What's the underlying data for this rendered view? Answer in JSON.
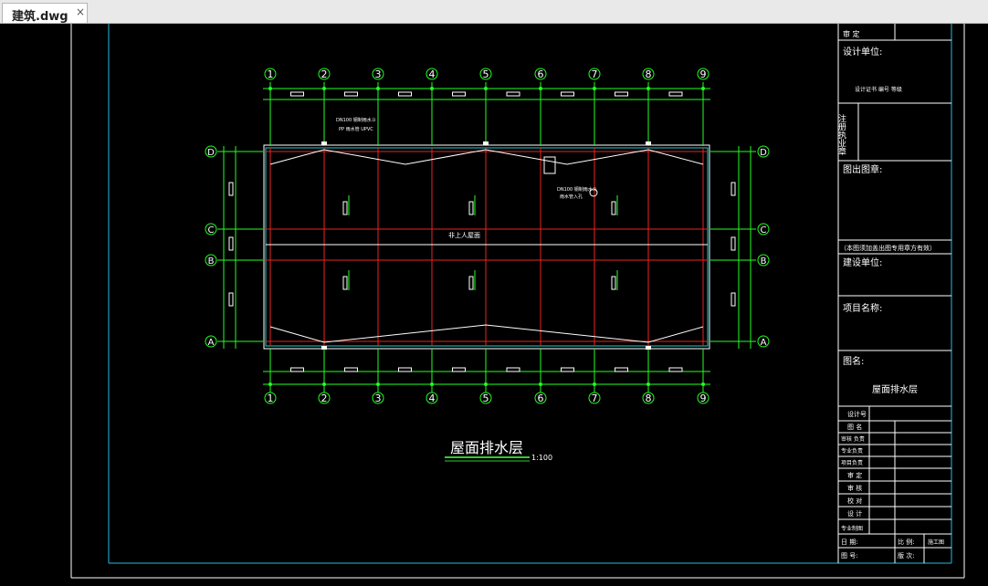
{
  "tab": {
    "filename": "建筑.dwg",
    "close_glyph": "×"
  },
  "drawing": {
    "roof_label": "非上人屋面",
    "note_left": "DN100 钢制雨水斗",
    "note_left_2": "PP 雨水管 UPVC",
    "note_right": "DN100 钢制雨水斗",
    "note_right_2": "雨水管入孔",
    "title": "屋面排水层",
    "scale": "1:100",
    "axis_numbers": [
      "1",
      "2",
      "3",
      "4",
      "5",
      "6",
      "7",
      "8",
      "9"
    ],
    "axis_letters": [
      "D",
      "C",
      "B",
      "A"
    ]
  },
  "title_block": {
    "row_top": "审 定",
    "design_unit": "设计单位:",
    "stamp_small": "设计证书 编号 等级",
    "reg_stamp": "注册执业章",
    "issue_stamp": "图出图章:",
    "note_stamp": "（本图须加盖出图专用章方有效）",
    "construct_unit": "建设单位:",
    "project_name": "项目名称:",
    "drawing_name_label": "图名:",
    "drawing_name": "屋面排水层",
    "rows": [
      "设计号",
      "图 名",
      "审核 负责",
      "专业负责",
      "项目负责",
      "审 定",
      "审 核",
      "校 对",
      "设 计",
      "专业制图"
    ],
    "footer": {
      "date_label": "日 期:",
      "scale_label": "比 例:",
      "sheet_label": "图 号:",
      "page_label": "版 次:",
      "stage": "施工图"
    }
  }
}
